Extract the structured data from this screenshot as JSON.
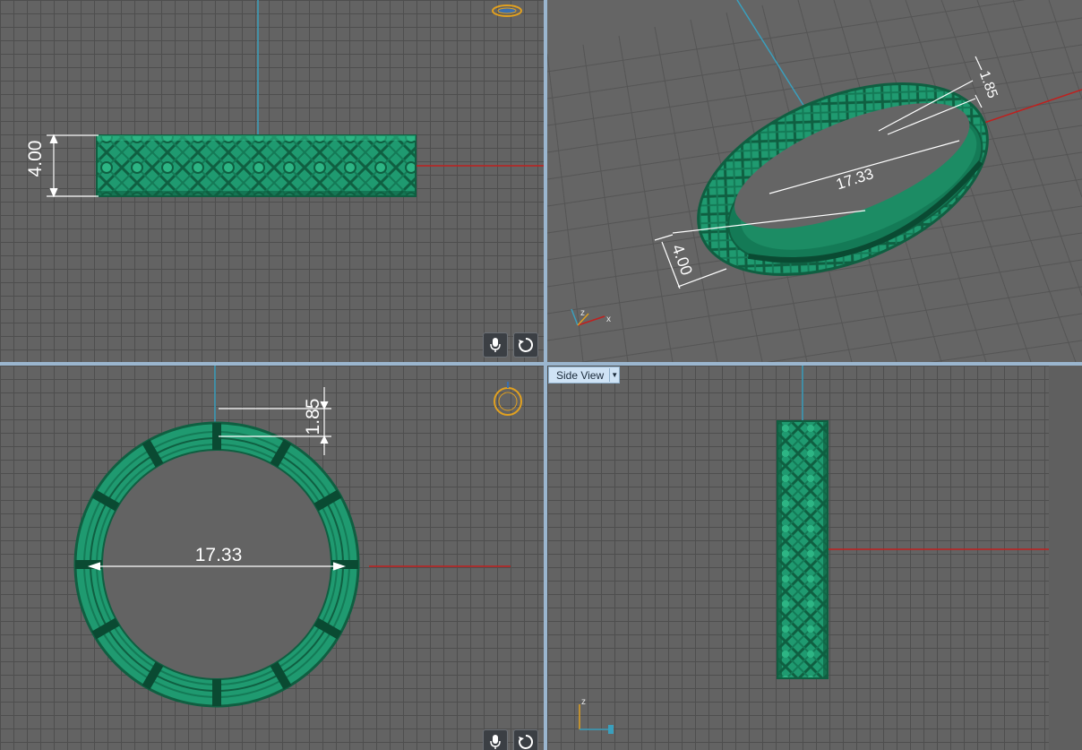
{
  "viewports": {
    "front": {
      "dimensions": {
        "height": "4.00"
      }
    },
    "perspective": {
      "dimensions": {
        "width": "1.85",
        "diameter": "17.33",
        "height": "4.00"
      },
      "axis_labels": {
        "z": "z",
        "x": "x"
      }
    },
    "top": {
      "dimensions": {
        "width": "1.85",
        "diameter": "17.33"
      }
    },
    "side": {
      "label": "Side View",
      "axis_labels": {
        "z": "z"
      }
    }
  },
  "icons": {
    "microphone": "microphone-icon",
    "rotate": "rotate-icon",
    "dropdown": "chevron-down-icon",
    "ring_thumbnail": "ring-thumbnail-icon"
  },
  "colors": {
    "ring": "#1f9a70",
    "ring_dark": "#0f5f41",
    "axis_red": "#c0201e",
    "axis_blue": "#3a9fbd",
    "divider": "#9bb6cf",
    "thumbnail": "#e0a020"
  }
}
